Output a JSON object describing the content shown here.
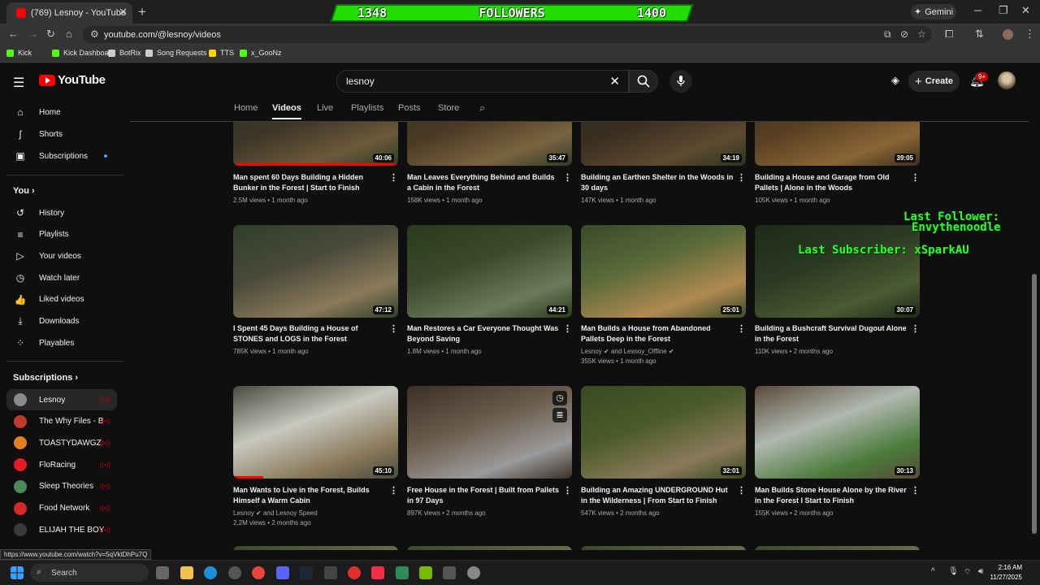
{
  "browser": {
    "tab_title": "(769) Lesnoy - YouTube",
    "url": "youtube.com/@lesnoy/videos",
    "gemini_label": "Gemini",
    "bookmarks": [
      {
        "label": "Kick",
        "color": "#53fc18"
      },
      {
        "label": "Kick Dashboard",
        "color": "#53fc18"
      },
      {
        "label": "BotRix",
        "color": "#cccccc"
      },
      {
        "label": "Song Requests",
        "color": "#cccccc"
      },
      {
        "label": "TTS",
        "color": "#ffd400"
      },
      {
        "label": "x_GooNz",
        "color": "#53fc18"
      }
    ]
  },
  "overlay": {
    "followers_current": "1348",
    "followers_label": "FOLLOWERS",
    "followers_goal": "1400",
    "last_follower_label": "Last Follower:",
    "last_follower_name": "Envythenoodle",
    "last_subscriber": "Last Subscriber: xSparkAU"
  },
  "header": {
    "logo_text": "YouTube",
    "search_value": "lesnoy",
    "create_label": "Create",
    "notif_badge": "9+"
  },
  "sidebar": {
    "main": [
      {
        "label": "Home",
        "icon": "home-icon",
        "glyph": "⌂"
      },
      {
        "label": "Shorts",
        "icon": "shorts-icon",
        "glyph": "ʃ"
      },
      {
        "label": "Subscriptions",
        "icon": "subscriptions-icon",
        "glyph": "▣"
      }
    ],
    "you_heading": "You",
    "you": [
      {
        "label": "History",
        "icon": "history-icon",
        "glyph": "↺"
      },
      {
        "label": "Playlists",
        "icon": "playlists-icon",
        "glyph": "≡"
      },
      {
        "label": "Your videos",
        "icon": "your-videos-icon",
        "glyph": "▷"
      },
      {
        "label": "Watch later",
        "icon": "watch-later-icon",
        "glyph": "◷"
      },
      {
        "label": "Liked videos",
        "icon": "like-icon",
        "glyph": "👍"
      },
      {
        "label": "Downloads",
        "icon": "download-icon",
        "glyph": "⤓"
      },
      {
        "label": "Playables",
        "icon": "playables-icon",
        "glyph": "⁘"
      }
    ],
    "subs_heading": "Subscriptions",
    "subs": [
      {
        "label": "Lesnoy",
        "color": "#8a8a8a"
      },
      {
        "label": "The Why Files - B...",
        "color": "#c0392b"
      },
      {
        "label": "TOASTYDAWGZ",
        "color": "#e67e22"
      },
      {
        "label": "FloRacing",
        "color": "#e51b23"
      },
      {
        "label": "Sleep Theories",
        "color": "#4a8a5a"
      },
      {
        "label": "Food Network",
        "color": "#d62828"
      },
      {
        "label": "ELIJAH THE BOY",
        "color": "#3a3a3a"
      }
    ]
  },
  "channel_tabs": [
    "Home",
    "Videos",
    "Live",
    "Playlists",
    "Posts",
    "Store"
  ],
  "active_tab": "Videos",
  "videos": [
    {
      "title": "Man spent 60 Days Building a Hidden Bunker in the Forest | Start to Finish",
      "meta1": "2.5M views • 1 month ago",
      "meta2": "",
      "duration": "40:06"
    },
    {
      "title": "Man Leaves Everything Behind and Builds a Cabin in the Forest",
      "meta1": "158K views • 1 month ago",
      "meta2": "",
      "duration": "35:47"
    },
    {
      "title": "Building an Earthen Shelter in the Woods in 30 days",
      "meta1": "147K views • 1 month ago",
      "meta2": "",
      "duration": "34:19"
    },
    {
      "title": "Building a House and Garage from Old Pallets | Alone in the Woods",
      "meta1": "105K views • 1 month ago",
      "meta2": "",
      "duration": "39:05"
    },
    {
      "title": "I Spent 45 Days Building a House of STONES and LOGS in the Forest",
      "meta1": "785K views • 1 month ago",
      "meta2": "",
      "duration": "47:12"
    },
    {
      "title": "Man Restores a Car Everyone Thought Was Beyond Saving",
      "meta1": "1.8M views • 1 month ago",
      "meta2": "",
      "duration": "44:21"
    },
    {
      "title": "Man Builds a House from Abandoned Pallets Deep in the Forest",
      "meta1": "Lesnoy ✔ and Lesnoy_Offline ✔",
      "meta2": "355K views • 1 month ago",
      "duration": "25:01"
    },
    {
      "title": "Building a Bushcraft Survival Dugout Alone in the Forest",
      "meta1": "110K views • 2 months ago",
      "meta2": "",
      "duration": "30:07"
    },
    {
      "title": "Man Wants to Live in the Forest, Builds Himself a Warm Cabin",
      "meta1": "Lesnoy ✔ and Lesnoy Speed",
      "meta2": "2.2M views • 2 months ago",
      "duration": "45:10"
    },
    {
      "title": "Free House in the Forest | Built from Pallets in 97 Days",
      "meta1": "897K views • 2 months ago",
      "meta2": "",
      "duration": ""
    },
    {
      "title": "Building an Amazing UNDERGROUND Hut in the Wilderness | From Start to Finish",
      "meta1": "547K views • 2 months ago",
      "meta2": "",
      "duration": "32:01"
    },
    {
      "title": "Man Builds Stone House Alone by the River in the Forest I Start to Finish",
      "meta1": "155K views • 2 months ago",
      "meta2": "",
      "duration": "30:13"
    }
  ],
  "status_url": "https://www.youtube.com/watch?v=5qVktDhPu7Q",
  "taskbar": {
    "search_label": "Search",
    "time": "2:16 AM",
    "date": "11/27/2025"
  }
}
